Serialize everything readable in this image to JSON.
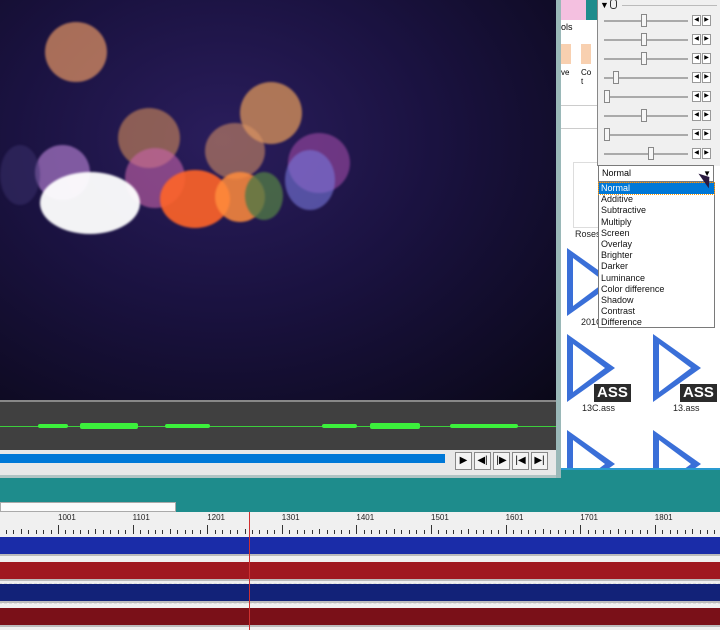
{
  "video": {
    "title": "video-preview"
  },
  "player": {
    "buttons": [
      {
        "name": "play",
        "glyph": "▶"
      },
      {
        "name": "prev-frame",
        "glyph": "◀|"
      },
      {
        "name": "next-frame",
        "glyph": "|▶"
      },
      {
        "name": "go-start",
        "glyph": "|◀"
      },
      {
        "name": "go-end",
        "glyph": "▶|"
      }
    ],
    "progress_percent": 80
  },
  "explorer": {
    "ribbon_text": "ols",
    "ribbon_btn1": "ve",
    "ribbon_btn2": "Co t",
    "files": [
      {
        "name": "Roses"
      },
      {
        "name": "201C"
      },
      {
        "name": "13C.ass"
      },
      {
        "name": "13.ass"
      }
    ],
    "badge": "ASS"
  },
  "props": {
    "header_icon": "mouse-icon",
    "sliders": [
      0.48,
      0.48,
      0.48,
      0.12,
      0.0,
      0.48,
      0.0,
      0.57
    ],
    "blend_mode": "Normal",
    "options": [
      "Normal",
      "Additive",
      "Subtractive",
      "Multiply",
      "Screen",
      "Overlay",
      "Brighter",
      "Darker",
      "Luminance",
      "Color difference",
      "Shadow",
      "Contrast",
      "Difference"
    ],
    "stepper_left": "◀",
    "stepper_right": "▶",
    "dropdown_arrow": "▼"
  },
  "timeline": {
    "ruler_labels": [
      "1001",
      "1101",
      "1201",
      "1301",
      "1401",
      "1501",
      "1601",
      "1701",
      "1801"
    ],
    "track_colors": [
      "#1a2ca8",
      "#a01820",
      "#122278",
      "#7a1018"
    ]
  }
}
